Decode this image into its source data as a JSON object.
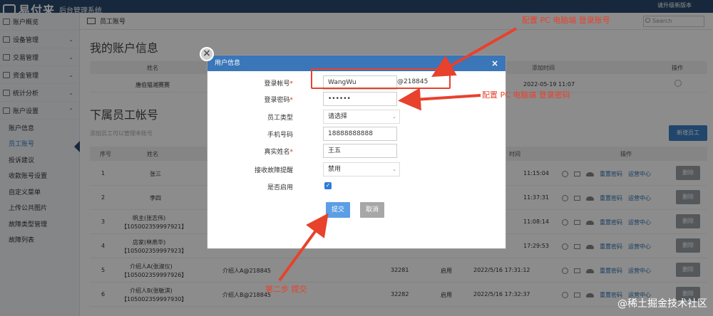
{
  "header": {
    "logo": "易付来",
    "subtitle": "后台管理系统",
    "right_text": "请升级新版本"
  },
  "sidebar": {
    "groups": [
      {
        "label": "账户概览"
      },
      {
        "label": "设备管理"
      },
      {
        "label": "交易管理"
      },
      {
        "label": "资金管理"
      },
      {
        "label": "统计分析"
      },
      {
        "label": "账户设置"
      }
    ],
    "sub_items": [
      "账户信息",
      "员工账号",
      "投诉建议",
      "收款账号设置",
      "自定义菜单",
      "上传公共图片",
      "故障类型管理",
      "故障列表"
    ]
  },
  "crumb": {
    "label": "员工账号",
    "search_placeholder": "Search"
  },
  "account_section": {
    "title": "我的账户信息",
    "headers": [
      "姓名",
      "添加时间",
      "操作"
    ],
    "row": {
      "name": "唐伯猫湘赛赛",
      "time": "2022-05-19 11:07"
    }
  },
  "staff_section": {
    "title": "下属员工帐号",
    "hint": "添加员工可以管理本账号",
    "add_button": "新增员工",
    "headers": [
      "序号",
      "姓名",
      "时间",
      "操作"
    ],
    "rows": [
      {
        "idx": "1",
        "name": "张三",
        "name2": "",
        "account": "",
        "code": "",
        "status": "",
        "time": "11:15:04"
      },
      {
        "idx": "2",
        "name": "李四",
        "name2": "",
        "account": "",
        "code": "",
        "status": "",
        "time": "11:37:31"
      },
      {
        "idx": "3",
        "name": "帆主(张志伟)",
        "name2": "【105002359997921】",
        "account": "",
        "code": "",
        "status": "",
        "time": "11:08:14"
      },
      {
        "idx": "4",
        "name": "店家(林燕华)",
        "name2": "【105002359997923】",
        "account": "",
        "code": "",
        "status": "",
        "time": "17:29:53"
      },
      {
        "idx": "5",
        "name": "介绍人A(张淑仪)",
        "name2": "【105002359997926】",
        "account": "介绍人A@218845",
        "code": "32281",
        "status": "启用",
        "time": "2022/5/16 17:31:12"
      },
      {
        "idx": "6",
        "name": "介绍人B(张敏淇)",
        "name2": "【105002359997930】",
        "account": "介绍人B@218845",
        "code": "32282",
        "status": "启用",
        "time": "2022/5/16 17:32:37"
      }
    ],
    "ops": {
      "reset_pwd": "重置密码",
      "ops_center": "运营中心",
      "delete": "删除"
    }
  },
  "modal": {
    "title": "用户信息",
    "close": "×",
    "fields": {
      "login_account": {
        "label": "登录帐号",
        "value": "WangWu",
        "suffix": "@218845"
      },
      "login_password": {
        "label": "登录密码",
        "value": "••••••"
      },
      "staff_type": {
        "label": "员工类型",
        "value": "请选择"
      },
      "phone": {
        "label": "手机号码",
        "value": "18888888888"
      },
      "real_name": {
        "label": "真实姓名",
        "value": "王五"
      },
      "fault_alert": {
        "label": "接收故障提醒",
        "value": "禁用"
      },
      "enabled": {
        "label": "是否启用",
        "checked": true
      }
    },
    "submit": "提交",
    "cancel": "取消"
  },
  "annotations": {
    "account_note": "配置 PC 电脑端 登录账号",
    "password_note": "配置 PC 电脑端  登录密码",
    "step_note": "第二步   提交",
    "color": "#e8412c"
  },
  "watermark": "@稀土掘金技术社区"
}
